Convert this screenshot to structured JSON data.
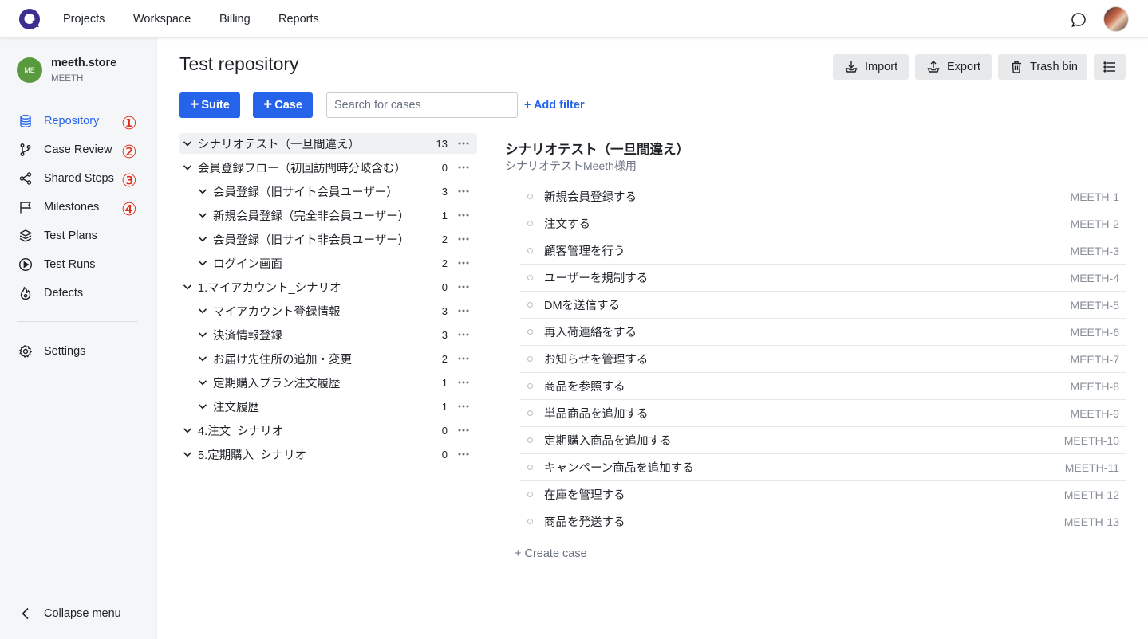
{
  "topnav": {
    "items": [
      "Projects",
      "Workspace",
      "Billing",
      "Reports"
    ]
  },
  "org": {
    "initials": "ME",
    "name": "meeth.store",
    "sub": "MEETH"
  },
  "sidebar": {
    "items": [
      {
        "label": "Repository",
        "icon": "database-icon",
        "active": true
      },
      {
        "label": "Case Review",
        "icon": "git-branch-icon"
      },
      {
        "label": "Shared Steps",
        "icon": "share-icon"
      },
      {
        "label": "Milestones",
        "icon": "flag-icon"
      },
      {
        "label": "Test Plans",
        "icon": "layers-icon"
      },
      {
        "label": "Test Runs",
        "icon": "play-circle-icon"
      },
      {
        "label": "Defects",
        "icon": "flame-icon"
      }
    ],
    "annotations": [
      "①",
      "②",
      "③",
      "④"
    ],
    "settings_label": "Settings",
    "collapse_label": "Collapse menu"
  },
  "header": {
    "title": "Test repository",
    "import_label": "Import",
    "export_label": "Export",
    "trash_label": "Trash bin"
  },
  "toolbar": {
    "suite_label": "Suite",
    "case_label": "Case",
    "search_placeholder": "Search for cases",
    "add_filter_label": "+ Add filter"
  },
  "tree": [
    {
      "name": "シナリオテスト（一旦間違え）",
      "count": "13",
      "level": 0,
      "selected": true
    },
    {
      "name": "会員登録フロー（初回訪問時分岐含む）",
      "count": "0",
      "level": 0
    },
    {
      "name": "会員登録（旧サイト会員ユーザー）",
      "count": "3",
      "level": 1
    },
    {
      "name": "新規会員登録（完全非会員ユーザー）",
      "count": "1",
      "level": 1
    },
    {
      "name": "会員登録（旧サイト非会員ユーザー）",
      "count": "2",
      "level": 1
    },
    {
      "name": "ログイン画面",
      "count": "2",
      "level": 1
    },
    {
      "name": "1.マイアカウント_シナリオ",
      "count": "0",
      "level": 0
    },
    {
      "name": "マイアカウント登録情報",
      "count": "3",
      "level": 1
    },
    {
      "name": "決済情報登録",
      "count": "3",
      "level": 1
    },
    {
      "name": "お届け先住所の追加・変更",
      "count": "2",
      "level": 1
    },
    {
      "name": "定期購入プラン注文履歴",
      "count": "1",
      "level": 1
    },
    {
      "name": "注文履歴",
      "count": "1",
      "level": 1
    },
    {
      "name": "4.注文_シナリオ",
      "count": "0",
      "level": 0
    },
    {
      "name": "5.定期購入_シナリオ",
      "count": "0",
      "level": 0
    }
  ],
  "detail": {
    "title": "シナリオテスト（一旦間違え）",
    "description": "シナリオテストMeeth様用",
    "cases": [
      {
        "name": "新規会員登録する",
        "id": "MEETH-1"
      },
      {
        "name": "注文する",
        "id": "MEETH-2"
      },
      {
        "name": "顧客管理を行う",
        "id": "MEETH-3"
      },
      {
        "name": "ユーザーを規制する",
        "id": "MEETH-4"
      },
      {
        "name": "DMを送信する",
        "id": "MEETH-5"
      },
      {
        "name": "再入荷連絡をする",
        "id": "MEETH-6"
      },
      {
        "name": "お知らせを管理する",
        "id": "MEETH-7"
      },
      {
        "name": "商品を参照する",
        "id": "MEETH-8"
      },
      {
        "name": "単品商品を追加する",
        "id": "MEETH-9"
      },
      {
        "name": "定期購入商品を追加する",
        "id": "MEETH-10"
      },
      {
        "name": "キャンペーン商品を追加する",
        "id": "MEETH-11"
      },
      {
        "name": "在庫を管理する",
        "id": "MEETH-12"
      },
      {
        "name": "商品を発送する",
        "id": "MEETH-13"
      }
    ],
    "create_case_label": "+ Create case"
  },
  "colors": {
    "primary": "#2563eb",
    "annotation_red": "#e02a14",
    "org_avatar": "#5a9a3e",
    "logo": "#3b2f8f"
  }
}
